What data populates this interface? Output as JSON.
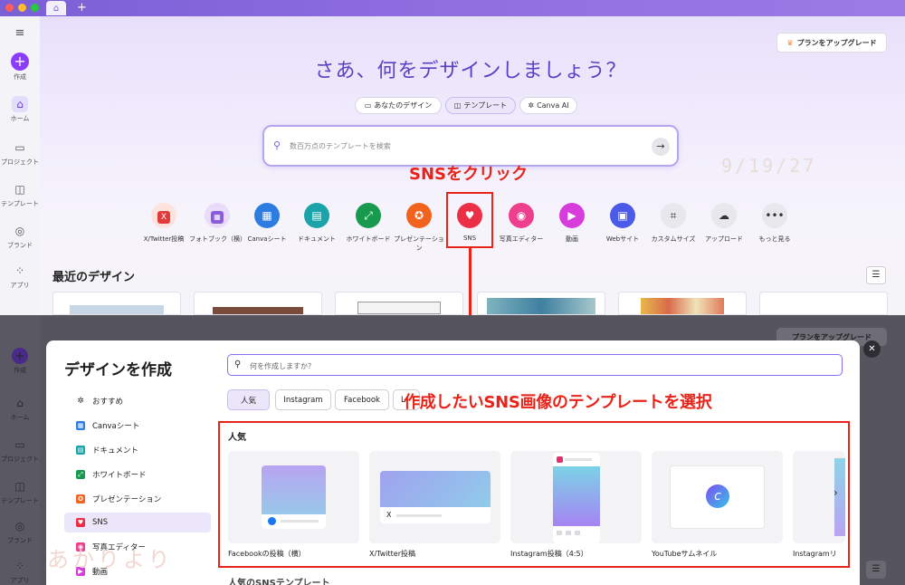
{
  "top": {
    "hero_title": "さあ、何をデザインしましょう？",
    "upgrade_label": "プランをアップグレード",
    "segments": [
      "あなたのデザイン",
      "テンプレート",
      "Canva AI"
    ],
    "search_placeholder": "数百万点のテンプレートを検索",
    "watermark_date": "9/19/27",
    "callout": "SNSをクリック",
    "categories": [
      "X/Twitter投稿",
      "フォトブック（横）",
      "Canvaシート",
      "ドキュメント",
      "ホワイトボード",
      "プレゼンテーション",
      "SNS",
      "写真エディター",
      "動画",
      "Webサイト",
      "カスタムサイズ",
      "アップロード",
      "もっと見る"
    ],
    "recent_title": "最近のデザイン"
  },
  "sidebar": {
    "items": [
      "作成",
      "ホーム",
      "プロジェクト",
      "テンプレート",
      "ブランド",
      "アプリ"
    ]
  },
  "modal": {
    "title": "デザインを作成",
    "search_placeholder": "何を作成しますか？",
    "menu": [
      "おすすめ",
      "Canvaシート",
      "ドキュメント",
      "ホワイトボード",
      "プレゼンテーション",
      "SNS",
      "写真エディター",
      "動画"
    ],
    "chips": [
      "人気",
      "Instagram",
      "Facebook",
      "L"
    ],
    "callout": "作成したいSNS画像のテンプレートを選択",
    "popular_title": "人気",
    "cards": [
      "Facebookの投稿（横）",
      "X/Twitter投稿",
      "Instagram投稿（4:5）",
      "YouTubeサムネイル",
      "Instagramリ"
    ],
    "bottom_section": "人気のSNSテンプレート",
    "upgrade_label": "プランをアップグレード",
    "watermark": "あかりより"
  },
  "colors": {
    "accent": "#8b3dff",
    "callout_red": "#e8241a",
    "title_purple": "#5b3fc4"
  }
}
